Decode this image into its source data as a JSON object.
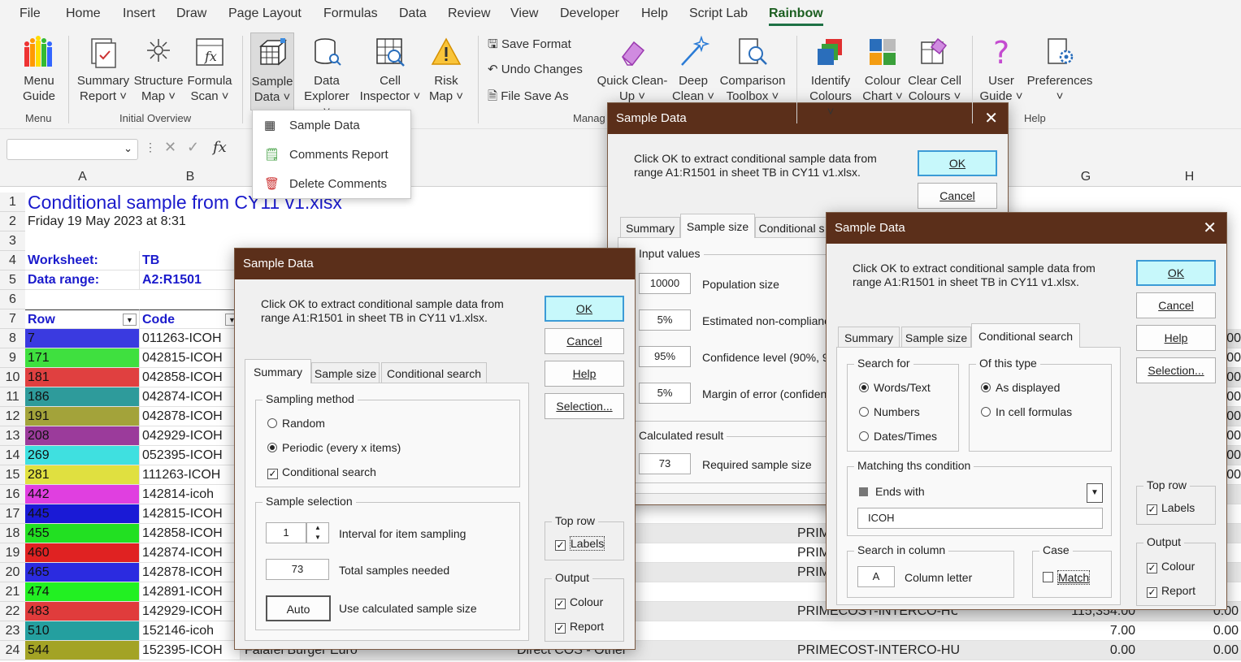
{
  "menu": [
    "File",
    "Home",
    "Insert",
    "Draw",
    "Page Layout",
    "Formulas",
    "Data",
    "Review",
    "View",
    "Developer",
    "Help",
    "Script Lab",
    "Rainbow"
  ],
  "ribbon": {
    "menu_guide": [
      "Menu",
      "Guide"
    ],
    "summary_report": [
      "Summary",
      "Report ˅"
    ],
    "structure_map": [
      "Structure",
      "Map ˅"
    ],
    "formula_scan": [
      "Formula",
      "Scan ˅"
    ],
    "sample_data": [
      "Sample",
      "Data ˅"
    ],
    "data_explorer": [
      "Data",
      "Explorer ˅"
    ],
    "cell_inspector": [
      "Cell",
      "Inspector ˅"
    ],
    "risk_map": [
      "Risk",
      "Map ˅"
    ],
    "save_format": "Save Format",
    "undo_changes": "Undo Changes",
    "file_save_as": "File Save As",
    "quick_cleanup": [
      "Quick Clean-",
      "Up ˅"
    ],
    "deep_clean": [
      "Deep",
      "Clean ˅"
    ],
    "comparison_toolbox": [
      "Comparison",
      "Toolbox ˅"
    ],
    "identify_colours": [
      "Identify",
      "Colours ˅"
    ],
    "colour_chart": [
      "Colour",
      "Chart ˅"
    ],
    "clear_cell_colours": [
      "Clear Cell",
      "Colours ˅"
    ],
    "user_guide": [
      "User",
      "Guide ˅"
    ],
    "preferences": [
      "Preferences",
      "˅"
    ],
    "groups": {
      "menu": "Menu",
      "initial_overview": "Initial Overview",
      "manage": "Manag",
      "help": "Help"
    }
  },
  "dropdown": [
    "Sample Data",
    "Comments Report",
    "Delete Comments"
  ],
  "formula": {
    "fx": "fx"
  },
  "columns": [
    "A",
    "B",
    "G",
    "H"
  ],
  "sheet": {
    "title": "Conditional sample from CY11 v1.xlsx",
    "date": "Friday 19 May 2023 at 8:31",
    "worksheet_label": "Worksheet:",
    "worksheet_value": "TB",
    "range_label": "Data range:",
    "range_value": "A2:R1501",
    "hdr_row": "Row",
    "hdr_code": "Code",
    "row_numbers": [
      "1",
      "2",
      "3",
      "4",
      "5",
      "6",
      "7",
      "8",
      "9",
      "10",
      "11",
      "12",
      "13",
      "14",
      "15",
      "16",
      "17",
      "18",
      "19",
      "20",
      "21",
      "22",
      "23",
      "24"
    ],
    "data": [
      {
        "row": "7",
        "code": "011263-ICOH",
        "color": "#3a3ae0"
      },
      {
        "row": "171",
        "code": "042815-ICOH",
        "color": "#3fe03f"
      },
      {
        "row": "181",
        "code": "042858-ICOH",
        "color": "#e04040"
      },
      {
        "row": "186",
        "code": "042874-ICOH",
        "color": "#2e9b9b"
      },
      {
        "row": "191",
        "code": "042878-ICOH",
        "color": "#a3a33a"
      },
      {
        "row": "208",
        "code": "042929-ICOH",
        "color": "#9b3b9b"
      },
      {
        "row": "269",
        "code": "052395-ICOH",
        "color": "#3fe0e0"
      },
      {
        "row": "281",
        "code": "111263-ICOH",
        "color": "#e0e040"
      },
      {
        "row": "442",
        "code": "142814-icoh",
        "color": "#e03fe0"
      },
      {
        "row": "445",
        "code": "142815-ICOH",
        "color": "#1a1ad6"
      },
      {
        "row": "455",
        "code": "142858-ICOH",
        "color": "#22e022"
      },
      {
        "row": "460",
        "code": "142874-ICOH",
        "color": "#e02222"
      },
      {
        "row": "465",
        "code": "142878-ICOH",
        "color": "#2b2be0"
      },
      {
        "row": "474",
        "code": "142891-ICOH",
        "color": "#22f022"
      },
      {
        "row": "483",
        "code": "142929-ICOH",
        "color": "#e03c3c"
      },
      {
        "row": "510",
        "code": "152146-icoh",
        "color": "#249f9f"
      },
      {
        "row": "544",
        "code": "152395-ICOH",
        "color": "#a3a325"
      }
    ],
    "partial": {
      "r18_f": "PRIM",
      "r19_f": "PRIM",
      "r20_f": "PRIM",
      "r22_f": "PRIMECOST-INTERCO-HU",
      "r22_g": "115,354.00",
      "r22_h": "0.00",
      "r23_g": "7.00",
      "r23_h": "0.00",
      "r24_c": "Falafel Burger Euro",
      "r24_d": "Direct COS - Other",
      "r24_f": "PRIMECOST-INTERCO-HU",
      "r24_g": "0.00",
      "r24_h": "0.00",
      "h_vals": [
        ".00",
        ".00",
        ".00",
        ".00",
        ".00",
        ".00",
        ".00",
        ".00"
      ]
    }
  },
  "dialog1": {
    "title": "Sample Data",
    "msg": [
      "Click OK to extract conditional sample data from",
      "range A1:R1501 in sheet TB in CY11 v1.xlsx."
    ],
    "ok": "OK",
    "cancel": "Cancel",
    "help": "Help",
    "selection": "Selection...",
    "tabs": [
      "Summary",
      "Sample size",
      "Conditional search"
    ],
    "sampling_method": "Sampling method",
    "random": "Random",
    "periodic": "Periodic (every x items)",
    "conditional": "Conditional search",
    "sample_selection": "Sample selection",
    "interval_value": "1",
    "interval_label": "Interval for item sampling",
    "total_value": "73",
    "total_label": "Total samples needed",
    "auto": "Auto",
    "auto_label": "Use calculated sample size",
    "top_row": "Top row",
    "labels": "Labels",
    "output": "Output",
    "colour": "Colour",
    "report": "Report"
  },
  "dialog2": {
    "title": "Sample Data",
    "msg": [
      "Click OK to extract conditional sample data from",
      "range A1:R1501 in sheet TB in CY11 v1.xlsx."
    ],
    "ok": "OK",
    "cancel": "Cancel",
    "tabs": [
      "Summary",
      "Sample size",
      "Conditional s"
    ],
    "input_values": "Input values",
    "pop_value": "10000",
    "pop_label": "Population size",
    "enc_value": "5%",
    "enc_label": "Estimated non-complianc",
    "conf_value": "95%",
    "conf_label": "Confidence level (90%, 9",
    "moe_value": "5%",
    "moe_label": "Margin of error (confiden",
    "calc_result": "Calculated result",
    "req_value": "73",
    "req_label": "Required sample size"
  },
  "dialog3": {
    "title": "Sample Data",
    "msg": [
      "Click OK to extract conditional sample data from",
      "range A1:R1501 in sheet TB in CY11 v1.xlsx."
    ],
    "ok": "OK",
    "cancel": "Cancel",
    "help": "Help",
    "selection": "Selection...",
    "tabs": [
      "Summary",
      "Sample size",
      "Conditional search"
    ],
    "search_for": "Search for",
    "words": "Words/Text",
    "numbers": "Numbers",
    "dates": "Dates/Times",
    "of_this_type": "Of this type",
    "as_displayed": "As displayed",
    "in_cell": "In cell formulas",
    "matching": "Matching ths condition",
    "ends_with": "Ends with",
    "condition_value": "ICOH",
    "search_col": "Search in column",
    "col_value": "A",
    "col_label": "Column letter",
    "case": "Case",
    "match": "Match",
    "top_row": "Top row",
    "labels": "Labels",
    "output": "Output",
    "colour": "Colour",
    "report": "Report"
  }
}
